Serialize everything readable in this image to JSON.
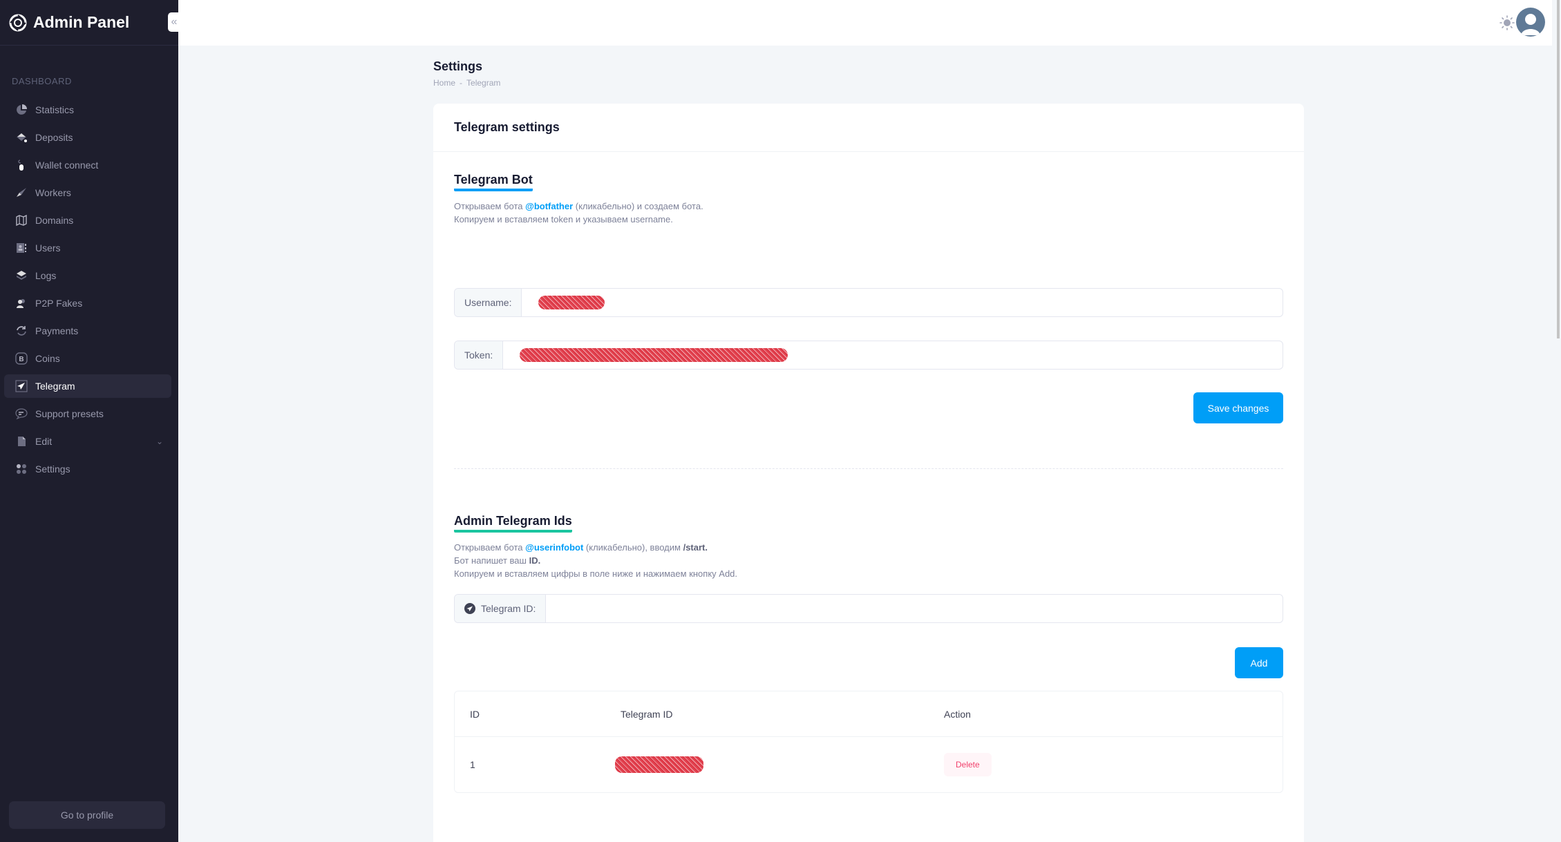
{
  "sidebar": {
    "brand": "Admin Panel",
    "collapse_icon": "double-chevron-left-icon",
    "section_label": "DASHBOARD",
    "items": [
      {
        "label": "Statistics",
        "icon": "pie-chart-icon"
      },
      {
        "label": "Deposits",
        "icon": "paint-bucket-icon"
      },
      {
        "label": "Wallet connect",
        "icon": "mouse-icon"
      },
      {
        "label": "Workers",
        "icon": "rocket-icon"
      },
      {
        "label": "Domains",
        "icon": "map-icon"
      },
      {
        "label": "Users",
        "icon": "address-book-icon"
      },
      {
        "label": "Logs",
        "icon": "layers-icon"
      },
      {
        "label": "P2P Fakes",
        "icon": "users-icon"
      },
      {
        "label": "Payments",
        "icon": "refresh-icon"
      },
      {
        "label": "Coins",
        "icon": "bitcoin-icon"
      },
      {
        "label": "Telegram",
        "icon": "telegram-icon",
        "active": true
      },
      {
        "label": "Support presets",
        "icon": "chat-icon"
      },
      {
        "label": "Edit",
        "icon": "file-icon",
        "has_submenu": true
      },
      {
        "label": "Settings",
        "icon": "grid-dots-icon"
      }
    ],
    "profile_button": "Go to profile"
  },
  "header": {
    "theme_icon": "sun-icon",
    "avatar_icon": "user-avatar-icon"
  },
  "page": {
    "title": "Settings",
    "breadcrumb": [
      "Home",
      "Telegram"
    ],
    "breadcrumb_separator": "-"
  },
  "card": {
    "title": "Telegram settings",
    "bot_section": {
      "heading": "Telegram Bot",
      "line1_prefix": "Открываем бота ",
      "line1_link": "@botfather",
      "line1_suffix": " (кликабельно) и создаем бота.",
      "line2": "Копируем и вставляем token и указываем username.",
      "username_label": "Username:",
      "username_value": "[redacted]",
      "token_label": "Token:",
      "token_value": "[redacted]",
      "save_button": "Save changes"
    },
    "admin_section": {
      "heading": "Admin Telegram Ids",
      "line1_prefix": "Открываем бота ",
      "line1_link": "@userinfobot",
      "line1_middle": " (кликабельно), вводим ",
      "line1_bold": "/start.",
      "line2_prefix": "Бот напишет ваш ",
      "line2_bold": "ID.",
      "line3": "Копируем и вставляем цифры в поле ниже и нажимаем кнопку Add.",
      "telegram_id_label": "Telegram ID:",
      "telegram_id_value": "",
      "add_button": "Add",
      "table": {
        "columns": [
          "ID",
          "Telegram ID",
          "Action"
        ],
        "rows": [
          {
            "id": "1",
            "telegram_id": "[redacted]",
            "action": "Delete"
          }
        ]
      }
    }
  },
  "colors": {
    "sidebar_bg": "#1e1e2d",
    "primary": "#009ef7",
    "accent_green": "#1bc5a0",
    "danger": "#f1416c",
    "redaction": "#d8202f"
  }
}
